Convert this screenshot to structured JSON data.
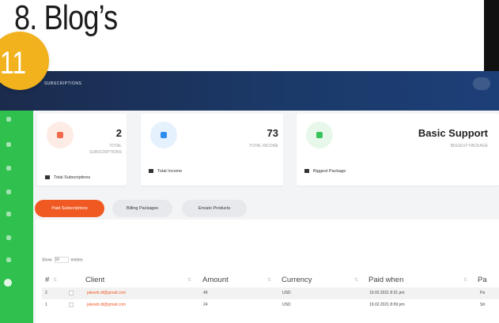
{
  "slide": {
    "title": "8. Blog’s",
    "badge": "11"
  },
  "app": {
    "header_title": "SUBSCRIPTIONS",
    "cards": [
      {
        "value": "2",
        "label_line1": "TOTAL",
        "label_line2": "SUBSCRIPTIONS",
        "footer": "Total Subscriptions",
        "accent": "#f26a4b"
      },
      {
        "value": "73",
        "label_line1": "TOTAL INCOME",
        "label_line2": "",
        "footer": "Total Income",
        "accent": "#2e8cf0"
      },
      {
        "value": "Basic Support",
        "label_line1": "BIGGEST PACKAGE",
        "label_line2": "",
        "footer": "Biggest Package",
        "accent": "#39c45a"
      }
    ],
    "tabs": [
      "Paid Subscriptions",
      "Billing Packages",
      "Envato Products"
    ],
    "table": {
      "show_label": "Show",
      "show_value": "10",
      "entries_label": "entries",
      "headers": [
        "#",
        "Client",
        "Amount",
        "Currency",
        "Paid when",
        "Pa"
      ],
      "rows": [
        {
          "num": "2",
          "client": "jakewb.dt@gmail.com",
          "amount": "49",
          "currency": "USD",
          "paid_when": "19.02.2021 8:31 pm",
          "pa": "Pa"
        },
        {
          "num": "1",
          "client": "jakewb.dt@gmail.com",
          "amount": "24",
          "currency": "USD",
          "paid_when": "19.02.2021 8:09 pm",
          "pa": "Str"
        }
      ]
    }
  },
  "colors": {
    "sidebar": "#2fc04e",
    "header": "#1b3a6a",
    "active_tab": "#f05a22",
    "badge": "#f2b21e"
  }
}
